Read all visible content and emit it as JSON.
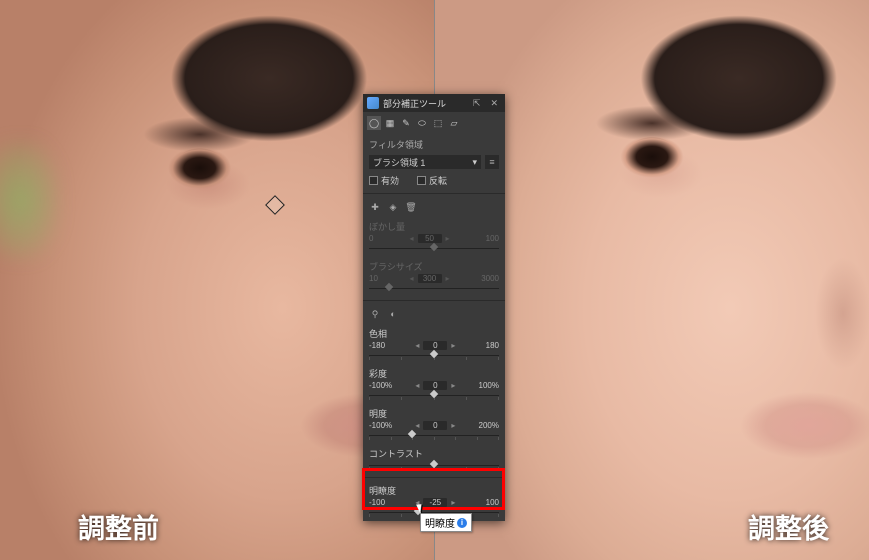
{
  "captions": {
    "before": "調整前",
    "after": "調整後"
  },
  "panel": {
    "title": "部分補正ツール",
    "pin_glyph": "⇱",
    "close_glyph": "✕",
    "filter_section": "フィルタ領域",
    "region_dropdown": "ブラシ領域 1",
    "enable_label": "有効",
    "invert_label": "反転",
    "blur_label": "ぼかし量",
    "blur_min": "0",
    "blur_value": "50",
    "blur_max": "100",
    "brushsize_label": "ブラシサイズ",
    "brushsize_min": "10",
    "brushsize_value": "300",
    "brushsize_max": "3000",
    "hue_label": "色相",
    "hue_min": "-180",
    "hue_value": "0",
    "hue_max": "180",
    "sat_label": "彩度",
    "sat_min": "-100%",
    "sat_value": "0",
    "sat_max": "100%",
    "bright_label": "明度",
    "bright_min": "-100%",
    "bright_value": "0",
    "bright_max": "200%",
    "contrast_label": "コントラスト",
    "clarity_label": "明瞭度",
    "clarity_min": "-100",
    "clarity_value": "-25",
    "clarity_max": "100"
  },
  "tooltip": {
    "text": "明瞭度"
  }
}
